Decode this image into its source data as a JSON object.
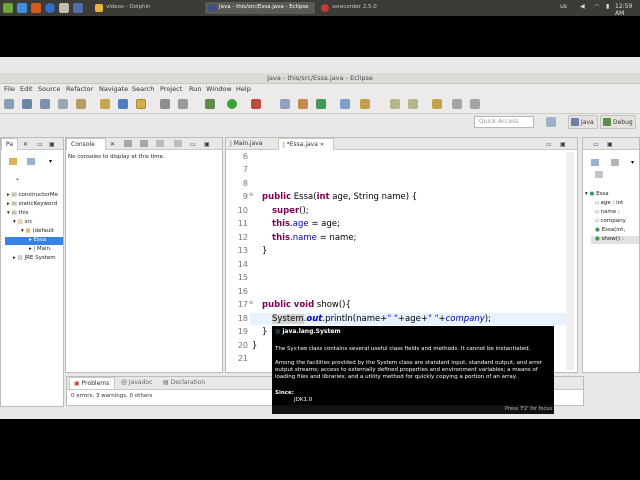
{
  "taskbar": {
    "items": [
      {
        "label": "videos - Dolphin",
        "active": false
      },
      {
        "label": "Java - this/src/Essa.java - Eclipse",
        "active": true
      },
      {
        "label": "ssrecorder 2.5.0",
        "active": false
      }
    ],
    "keyboard_layout": "us",
    "clock": "12:59 AM"
  },
  "window_title": "Java - this/src/Essa.java - Eclipse",
  "menu": [
    "File",
    "Edit",
    "Source",
    "Refactor",
    "Navigate",
    "Search",
    "Project",
    "Run",
    "Window",
    "Help"
  ],
  "quick_access_placeholder": "Quick Access",
  "perspectives": [
    "Java",
    "Debug"
  ],
  "package_explorer": {
    "tab": "Pa",
    "tree": [
      "constructorMe",
      "staticKeyword",
      "this",
      "src",
      "(default",
      "Essa",
      "Main.",
      "JRE System"
    ]
  },
  "console": {
    "tab": "Console",
    "message": "No consoles to display at this time."
  },
  "editor": {
    "tabs": [
      "Main.java",
      "*Essa.java"
    ],
    "line_numbers": [
      "6",
      "7",
      "8",
      "9",
      "10",
      "11",
      "12",
      "13",
      "14",
      "15",
      "16",
      "17",
      "18",
      "19",
      "20",
      "21"
    ],
    "fold_markers": [
      "⊖",
      "⊖"
    ]
  },
  "outline": {
    "class": "Essa",
    "members": [
      "age : int",
      "name : ",
      "company",
      "Essa(int,",
      "show() :"
    ]
  },
  "popup": {
    "title": "java.lang.System",
    "para1_a": "The",
    "para1_mono": "System",
    "para1_b": "class contains several useful class fields and methods. It cannot be instantiated.",
    "para2": "Among the facilities provided by the System class are standard input, standard output, and error output streams; access to externally defined properties and environment variables; a means of loading files and libraries; and a utility method for quickly copying a portion of an array.",
    "since_label": "Since:",
    "since_value": "JDK1.0",
    "footer": "Press 'F2' for focus"
  },
  "problems": {
    "tabs": [
      "Problems",
      "Javadoc",
      "Declaration"
    ],
    "summary": "0 errors, 3 warnings, 0 others"
  },
  "colors": {
    "keyword": "#7f0055",
    "field": "#0000c0",
    "panel_bg": "#ffffff",
    "chrome_bg": "#e8e8e7",
    "taskbar_bg": "#3c3b37"
  }
}
